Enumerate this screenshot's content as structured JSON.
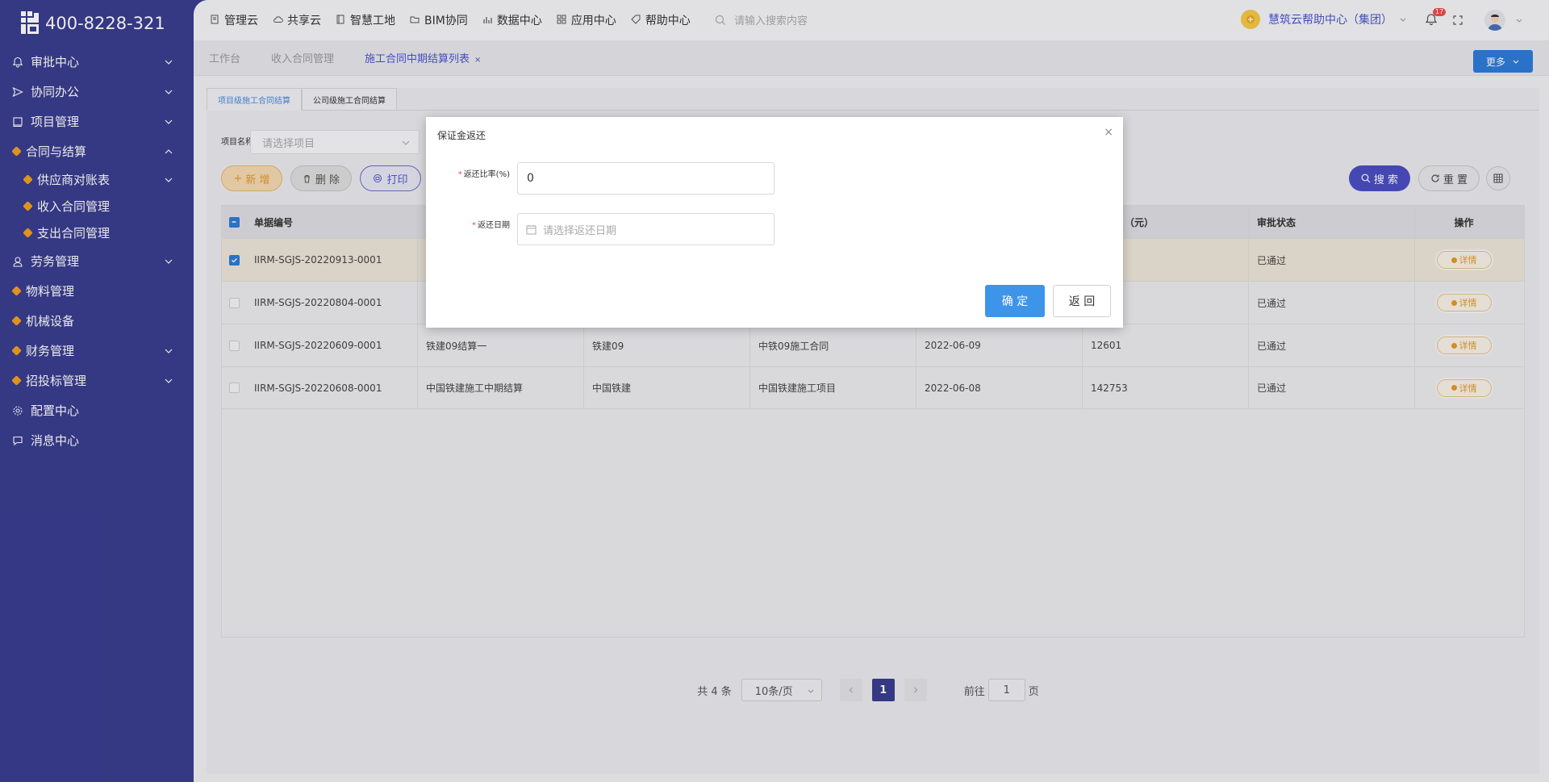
{
  "app": {
    "phone": "400-8228-321",
    "org_name": "慧筑云帮助中心（集团）",
    "notification_count": "17"
  },
  "sidebar": {
    "items": [
      {
        "label": "审批中心"
      },
      {
        "label": "协同办公"
      },
      {
        "label": "项目管理"
      },
      {
        "label": "合同与结算"
      },
      {
        "label": "供应商对账表"
      },
      {
        "label": "收入合同管理"
      },
      {
        "label": "支出合同管理"
      },
      {
        "label": "劳务管理"
      },
      {
        "label": "物料管理"
      },
      {
        "label": "机械设备"
      },
      {
        "label": "财务管理"
      },
      {
        "label": "招投标管理"
      },
      {
        "label": "配置中心"
      },
      {
        "label": "消息中心"
      }
    ]
  },
  "topnav": {
    "items": [
      {
        "label": "管理云"
      },
      {
        "label": "共享云"
      },
      {
        "label": "智慧工地"
      },
      {
        "label": "BIM协同"
      },
      {
        "label": "数据中心"
      },
      {
        "label": "应用中心"
      },
      {
        "label": "帮助中心"
      }
    ],
    "search_placeholder": "请输入搜索内容"
  },
  "tabs": {
    "items": [
      {
        "label": "工作台"
      },
      {
        "label": "收入合同管理"
      },
      {
        "label": "施工合同中期结算列表"
      }
    ],
    "more_label": "更多"
  },
  "subtabs": {
    "items": [
      {
        "label": "项目级施工合同结算"
      },
      {
        "label": "公司级施工合同结算"
      }
    ]
  },
  "filter": {
    "project_label": "项目名称",
    "project_placeholder": "请选择项目"
  },
  "toolbar": {
    "add_label": "新 增",
    "delete_label": "删 除",
    "print_label": "打印",
    "search_label": "搜 索",
    "reset_label": "重 置"
  },
  "table": {
    "headers": {
      "code": "单据编号",
      "amount_tail": "（元）",
      "status": "审批状态",
      "action": "操作"
    },
    "detail_label": "详情",
    "rows": [
      {
        "code": "IIRM-SGJS-20220913-0001",
        "name": "",
        "party": "",
        "contract": "",
        "date": "",
        "amount": "",
        "status": "已通过"
      },
      {
        "code": "IIRM-SGJS-20220804-0001",
        "name": "",
        "party": "",
        "contract": "",
        "date": "",
        "amount": "",
        "status": "已通过"
      },
      {
        "code": "IIRM-SGJS-20220609-0001",
        "name": "铁建09结算一",
        "party": "铁建09",
        "contract": "中铁09施工合同",
        "date": "2022-06-09",
        "amount": "12601",
        "status": "已通过"
      },
      {
        "code": "IIRM-SGJS-20220608-0001",
        "name": "中国铁建施工中期结算",
        "party": "中国铁建",
        "contract": "中国铁建施工项目",
        "date": "2022-06-08",
        "amount": "142753",
        "status": "已通过"
      }
    ]
  },
  "pagination": {
    "total": "共 4 条",
    "page_size": "10条/页",
    "current": "1",
    "goto_prefix": "前往",
    "goto_value": "1",
    "goto_suffix": "页"
  },
  "modal": {
    "title": "保证金返还",
    "ratio_label": "返还比率(%)",
    "ratio_value": "0",
    "date_label": "返还日期",
    "date_placeholder": "请选择返还日期",
    "ok_label": "确 定",
    "back_label": "返 回"
  }
}
